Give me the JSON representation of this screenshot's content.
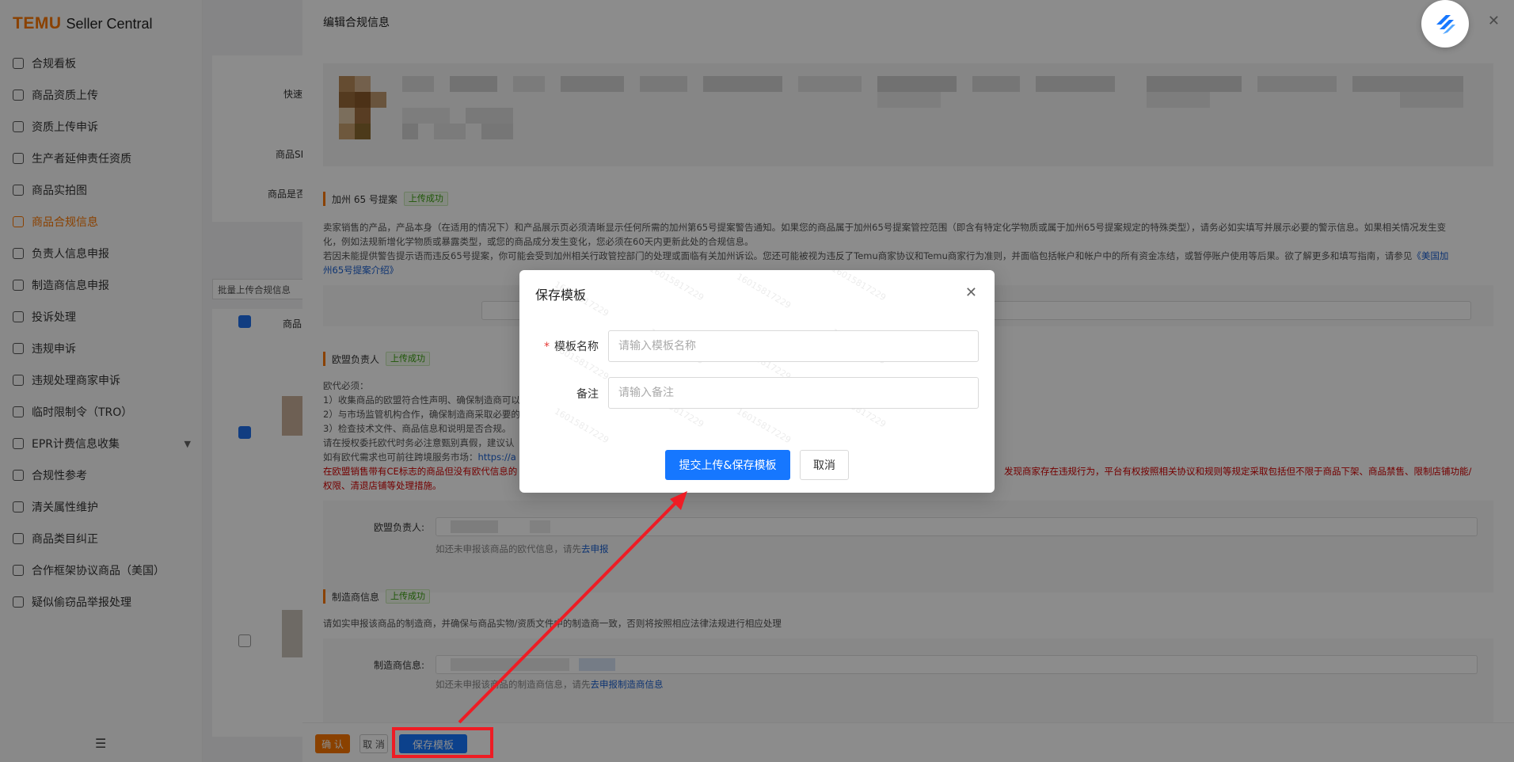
{
  "sidebar": {
    "brand": "TEMU",
    "brand_sub": "Seller Central",
    "items": [
      {
        "label": "合规看板",
        "icon": "chart-icon"
      },
      {
        "label": "商品资质上传",
        "icon": "upload-icon"
      },
      {
        "label": "资质上传申诉",
        "icon": "appeal-icon"
      },
      {
        "label": "生产者延伸责任资质",
        "icon": "producer-icon"
      },
      {
        "label": "商品实拍图",
        "icon": "photo-icon"
      },
      {
        "label": "商品合规信息",
        "icon": "document-icon",
        "active": true
      },
      {
        "label": "负责人信息申报",
        "icon": "person-icon"
      },
      {
        "label": "制造商信息申报",
        "icon": "factory-icon"
      },
      {
        "label": "投诉处理",
        "icon": "alert-icon"
      },
      {
        "label": "违规申诉",
        "icon": "violation-icon"
      },
      {
        "label": "违规处理商家申诉",
        "icon": "merchant-icon"
      },
      {
        "label": "临时限制令（TRO）",
        "icon": "calendar-icon"
      },
      {
        "label": "EPR计费信息收集",
        "icon": "billing-icon",
        "expandable": true
      },
      {
        "label": "合规性参考",
        "icon": "book-icon"
      },
      {
        "label": "清关属性维护",
        "icon": "list-icon"
      },
      {
        "label": "商品类目纠正",
        "icon": "category-icon"
      },
      {
        "label": "合作框架协议商品（美国）",
        "icon": "agreement-icon"
      },
      {
        "label": "疑似偷窃品举报处理",
        "icon": "report-icon"
      }
    ]
  },
  "background": {
    "label_fast": "快速",
    "label_sku": "商品SK",
    "label_is": "商品是否",
    "batch_upload": "批量上传合规信息",
    "col_product": "商品"
  },
  "drawer": {
    "title": "编辑合规信息",
    "prop65": {
      "title": "加州 65 号提案",
      "status": "上传成功",
      "p1": "卖家销售的产品，产品本身（在适用的情况下）和产品展示页必须清晰显示任何所需的加州第65号提案警告通知。如果您的商品属于加州65号提案管控范围（即含有特定化学物质或属于加州65号提案规定的特殊类型），请务必如实填写并展示必要的警示信息。如果相关情况发生变",
      "p2": "化，例如法规新增化学物质或暴露类型，或您的商品成分发生变化，您必须在60天内更新此处的合规信息。",
      "p3": "若因未能提供警告提示语而违反65号提案，你可能会受到加州相关行政管控部门的处理或面临有关加州诉讼。您还可能被视为违反了Temu商家协议和Temu商家行为准则，并面临包括帐户和帐户中的所有资金冻结，或暂停账户使用等后果。欲了解更多和填写指南，请参见",
      "link1": "《美国加",
      "link2": "州65号提案介绍》"
    },
    "eu": {
      "title": "欧盟负责人",
      "status": "上传成功",
      "l1": "欧代必须：",
      "l2": "1）收集商品的欧盟符合性声明、确保制造商可以",
      "l3": "2）与市场监管机构合作，确保制造商采取必要的",
      "l4": "3）检查技术文件、商品信息和说明是否合规。",
      "l5": "请在授权委托欧代时务必注意甄别真假，建议认",
      "l6": "如有欧代需求也可前往跨境服务市场：",
      "l6_link": "https://a",
      "red1_left": "在欧盟销售带有CE标志的商品但没有欧代信息的",
      "red1_right": "发现商家存在违规行为，平台有权按照相关协议和规则等规定采取包括但不限于商品下架、商品禁售、限制店铺功能/",
      "red2": "权限、清退店铺等处理措施。",
      "field_label": "欧盟负责人:",
      "hint": "如还未申报该商品的欧代信息，请先",
      "hint_link": "去申报"
    },
    "maker": {
      "title": "制造商信息",
      "status": "上传成功",
      "desc": "请如实申报该商品的制造商，并确保与商品实物/资质文件中的制造商一致，否则将按照相应法律法规进行相应处理",
      "field_label": "制造商信息:",
      "hint": "如还未申报该商品的制造商信息，请先",
      "hint_link": "去申报制造商信息"
    },
    "bottom": {
      "confirm": "确 认",
      "cancel": "取 消",
      "save_template": "保存模板"
    }
  },
  "modal": {
    "title": "保存模板",
    "name_label": "模板名称",
    "name_placeholder": "请输入模板名称",
    "note_label": "备注",
    "note_placeholder": "请输入备注",
    "submit": "提交上传&保存模板",
    "cancel": "取消",
    "watermark": "16015817229"
  },
  "colors": {
    "brand": "#fb7701",
    "primary": "#1677ff",
    "highlight": "#ee1c24",
    "success": "#389e0d"
  }
}
